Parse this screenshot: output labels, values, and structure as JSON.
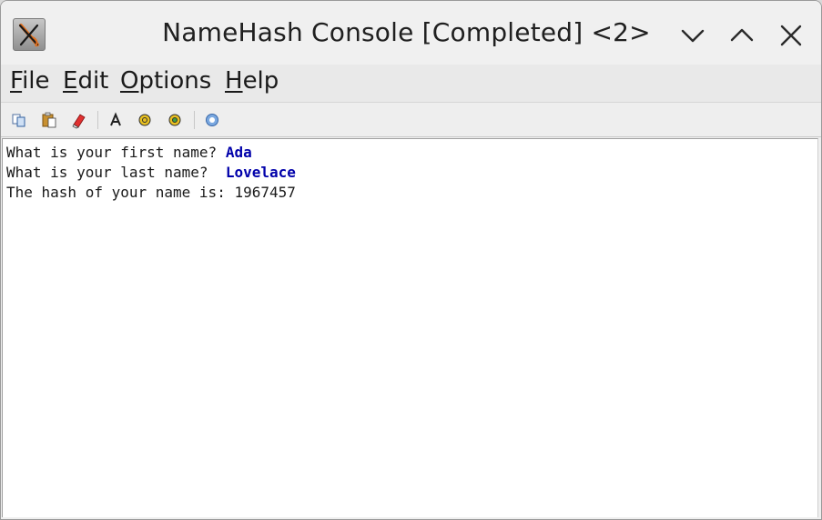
{
  "window": {
    "title": "NameHash Console [Completed] <2>"
  },
  "icons": {
    "app": "x-cross-app-icon",
    "minimize": "chevron-down-icon",
    "maximize": "chevron-up-icon",
    "close": "close-icon"
  },
  "menu": {
    "file": {
      "mnemonic": "F",
      "rest": "ile"
    },
    "edit": {
      "mnemonic": "E",
      "rest": "dit"
    },
    "options": {
      "mnemonic": "O",
      "rest": "ptions"
    },
    "help": {
      "mnemonic": "H",
      "rest": "elp"
    }
  },
  "toolbar": {
    "icons": [
      "copy-icon",
      "paste-icon",
      "clear-icon",
      "font-icon",
      "compile-icon",
      "debug-icon",
      "help-icon"
    ]
  },
  "console": {
    "line1": {
      "prompt": "What is your first name? ",
      "input": "Ada"
    },
    "line2": {
      "prompt": "What is your last name?  ",
      "input": "Lovelace"
    },
    "line3": {
      "text": "The hash of your name is: 1967457"
    }
  },
  "colors": {
    "input_text": "#0000aa",
    "console_bg": "#ffffff"
  }
}
